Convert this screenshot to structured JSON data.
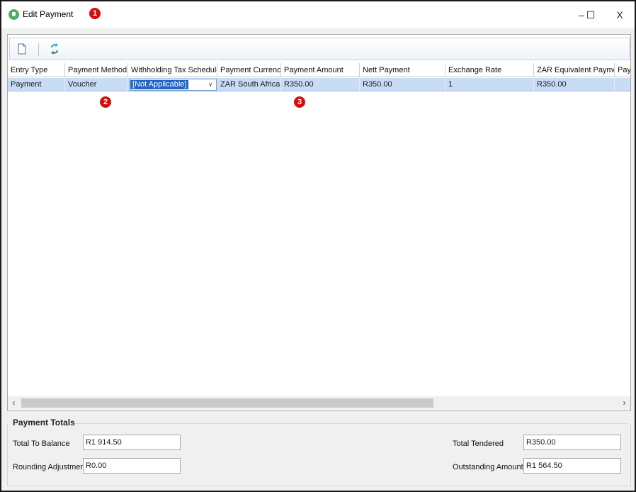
{
  "window": {
    "title": "Edit Payment",
    "controls": {
      "minimize": "–",
      "maximize": "☐",
      "close": "X"
    }
  },
  "markers": [
    "1",
    "2",
    "3"
  ],
  "toolbar": {
    "buttons": [
      {
        "name": "new-document-icon"
      },
      {
        "name": "refresh-icon"
      }
    ]
  },
  "grid": {
    "columns": [
      "Entry Type",
      "Payment Method",
      "Withholding Tax Schedule",
      "Payment Currency",
      "Payment Amount",
      "Nett Payment",
      "Exchange Rate",
      "ZAR Equivalent Payment",
      "Pay"
    ],
    "row": {
      "entry_type": "Payment",
      "payment_method": "Voucher",
      "withholding_tax_schedule": "[Not Applicable]",
      "payment_currency": "ZAR South African r",
      "payment_amount": "R350.00",
      "nett_payment": "R350.00",
      "exchange_rate": "1",
      "zar_equivalent_payment": "R350.00",
      "pay": ""
    }
  },
  "scroll": {
    "left": "‹",
    "right": "›"
  },
  "totals": {
    "section_title": "Payment Totals",
    "total_to_balance_label": "Total To Balance",
    "total_to_balance": "R1 914.50",
    "rounding_adjustment_label": "Rounding Adjustment",
    "rounding_adjustment": "R0.00",
    "total_tendered_label": "Total Tendered",
    "total_tendered": "R350.00",
    "outstanding_amount_label": "Outstanding Amount",
    "outstanding_amount": "R1 564.50"
  },
  "colors": {
    "selected_row": "#c9dcf6",
    "selection_highlight": "#1f63c6",
    "marker_red": "#d10f0f",
    "app_icon_green": "#4caf68"
  }
}
